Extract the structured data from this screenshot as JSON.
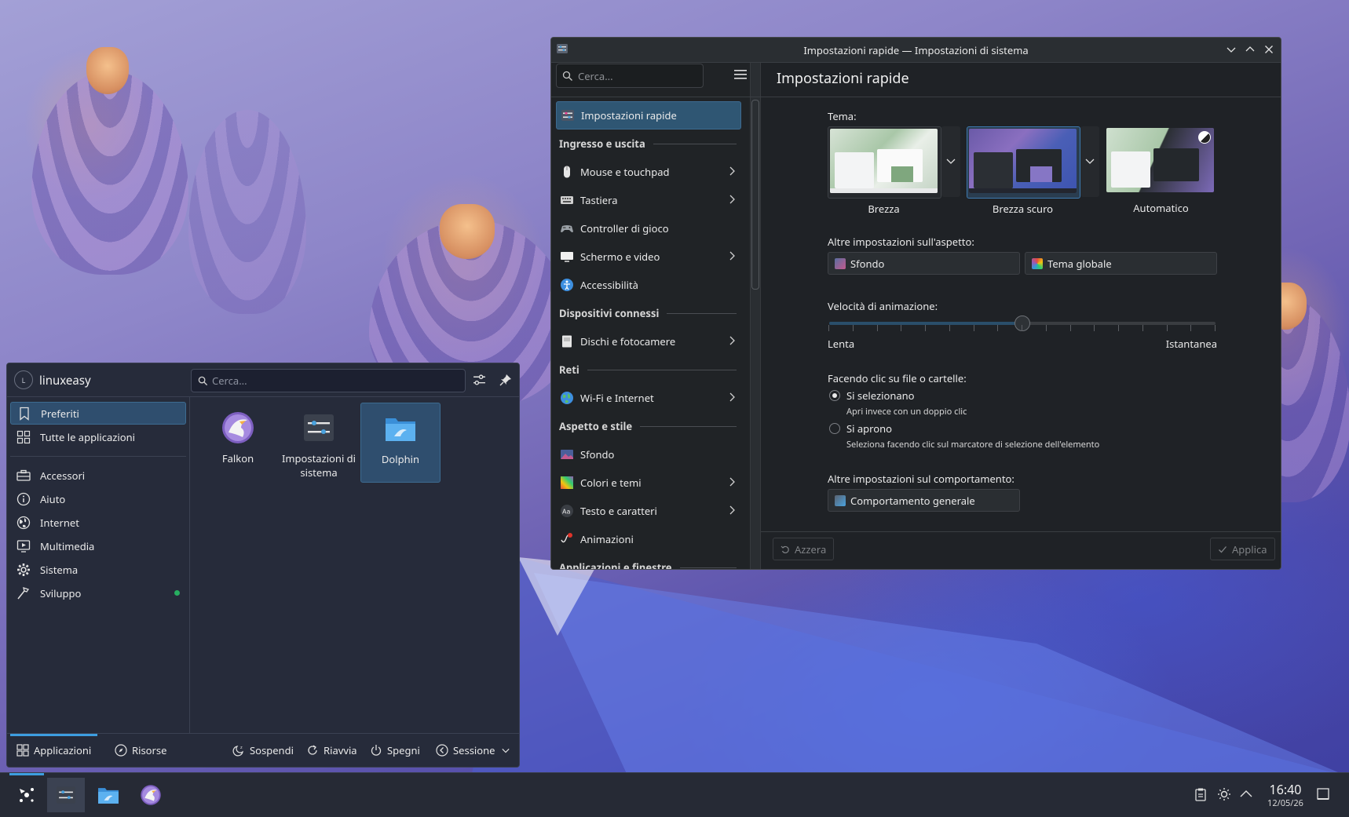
{
  "settings_window": {
    "title": "Impostazioni rapide — Impostazioni di sistema",
    "search_placeholder": "Cerca...",
    "page_title": "Impostazioni rapide",
    "nav": [
      {
        "type": "item",
        "label": "Impostazioni rapide",
        "icon": "quick-settings-icon",
        "selected": true
      },
      {
        "type": "section",
        "label": "Ingresso e uscita"
      },
      {
        "type": "item",
        "label": "Mouse e touchpad",
        "icon": "mouse-icon",
        "chevron": true
      },
      {
        "type": "item",
        "label": "Tastiera",
        "icon": "keyboard-icon",
        "chevron": true
      },
      {
        "type": "item",
        "label": "Controller di gioco",
        "icon": "gamepad-icon"
      },
      {
        "type": "item",
        "label": "Schermo e video",
        "icon": "monitor-icon",
        "chevron": true
      },
      {
        "type": "item",
        "label": "Accessibilità",
        "icon": "accessibility-icon"
      },
      {
        "type": "section",
        "label": "Dispositivi connessi"
      },
      {
        "type": "item",
        "label": "Dischi e fotocamere",
        "icon": "disk-icon",
        "chevron": true
      },
      {
        "type": "section",
        "label": "Reti"
      },
      {
        "type": "item",
        "label": "Wi-Fi e Internet",
        "icon": "globe-icon",
        "chevron": true
      },
      {
        "type": "section",
        "label": "Aspetto e stile"
      },
      {
        "type": "item",
        "label": "Sfondo",
        "icon": "wallpaper-icon"
      },
      {
        "type": "item",
        "label": "Colori e temi",
        "icon": "colors-icon",
        "chevron": true
      },
      {
        "type": "item",
        "label": "Testo e caratteri",
        "icon": "font-icon",
        "chevron": true
      },
      {
        "type": "item",
        "label": "Animazioni",
        "icon": "animation-icon"
      },
      {
        "type": "section",
        "label": "Applicazioni e finestre"
      }
    ],
    "theme_label": "Tema:",
    "themes": [
      {
        "name": "Brezza"
      },
      {
        "name": "Brezza scuro",
        "selected": true
      },
      {
        "name": "Automatico"
      }
    ],
    "appearance_label": "Altre impostazioni sull'aspetto:",
    "wallpaper_button": "Sfondo",
    "global_theme_button": "Tema globale",
    "animation_label": "Velocità di animazione:",
    "animation_speed_fraction": 0.5,
    "slow_label": "Lenta",
    "instant_label": "Istantanea",
    "click_label": "Facendo clic su file o cartelle:",
    "radio_select": "Si selezionano",
    "radio_select_hint": "Apri invece con un doppio clic",
    "radio_open": "Si aprono",
    "radio_open_hint": "Seleziona facendo clic sul marcatore di selezione dell'elemento",
    "behavior_label": "Altre impostazioni sul comportamento:",
    "general_behavior_button": "Comportamento generale",
    "reset_button": "Azzera",
    "apply_button": "Applica"
  },
  "launcher": {
    "avatar_letter": "L",
    "username": "linuxeasy",
    "search_placeholder": "Cerca...",
    "categories": [
      {
        "label": "Preferiti",
        "icon": "bookmark-icon",
        "selected": true
      },
      {
        "label": "Tutte le applicazioni",
        "icon": "grid-icon"
      },
      {
        "label": "Accessori",
        "icon": "accessories-icon"
      },
      {
        "label": "Aiuto",
        "icon": "help-icon"
      },
      {
        "label": "Internet",
        "icon": "globe-icon"
      },
      {
        "label": "Multimedia",
        "icon": "multimedia-icon"
      },
      {
        "label": "Sistema",
        "icon": "gear-icon"
      },
      {
        "label": "Sviluppo",
        "icon": "hammer-icon",
        "new": true
      }
    ],
    "apps": [
      {
        "label": "Falkon"
      },
      {
        "label": "Impostazioni di sistema"
      },
      {
        "label": "Dolphin",
        "selected": true
      }
    ],
    "footer": {
      "applications": "Applicazioni",
      "places": "Risorse",
      "suspend": "Sospendi",
      "restart": "Riavvia",
      "shutdown": "Spegni",
      "session": "Sessione"
    }
  },
  "taskbar": {
    "time": "16:40",
    "date": "12/05/26"
  },
  "colors": {
    "accent": "#3d9ee0",
    "selection": "#2f5673",
    "new_badge": "#27ae60"
  }
}
